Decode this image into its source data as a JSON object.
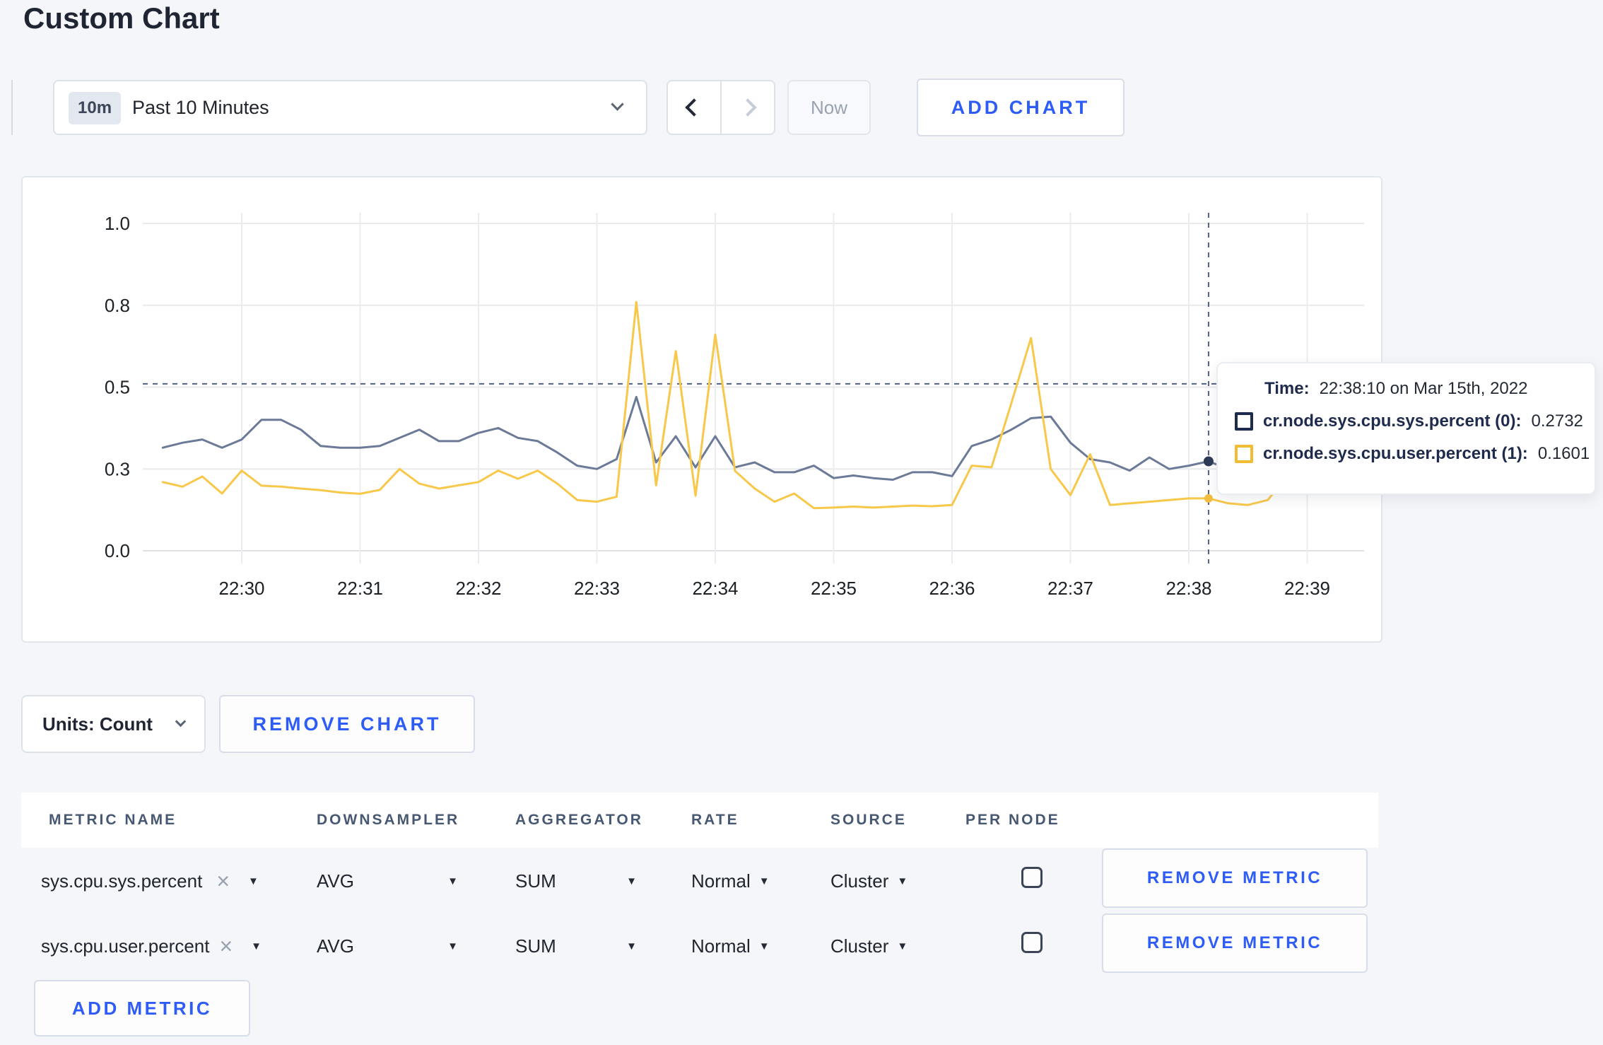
{
  "page_title": "Custom Chart",
  "icons": {
    "caret_down": "▼",
    "close": "×"
  },
  "colors": {
    "accent_blue": "#2e5cf6",
    "series_sys": "#6b7a96",
    "series_user": "#f8c84b",
    "swatch_sys": "#1e2b4d",
    "swatch_user": "#f0bc33",
    "crosshair": "#51607e",
    "page_bg": "#f4f6f9"
  },
  "toolbar": {
    "range_badge": "10m",
    "range_label": "Past 10 Minutes",
    "now_label": "Now",
    "add_chart_label": "ADD CHART"
  },
  "chart_data": {
    "type": "line",
    "title": "",
    "xlabel": "",
    "ylabel": "",
    "grid": true,
    "legend": "none",
    "ylim": [
      0,
      1
    ],
    "y_ticks": [
      {
        "value": 0,
        "label": "0.0"
      },
      {
        "value": 0.25,
        "label": "0.3"
      },
      {
        "value": 0.5,
        "label": "0.5"
      },
      {
        "value": 0.75,
        "label": "0.8"
      },
      {
        "value": 1,
        "label": "1.0"
      }
    ],
    "x_ticks": [
      "22:30",
      "22:31",
      "22:32",
      "22:33",
      "22:34",
      "22:35",
      "22:36",
      "22:37",
      "22:38",
      "22:39"
    ],
    "x_start_time": "22:29:20",
    "x_step_seconds": 10,
    "x0_min": -0.6667,
    "dx_min": 0.16667,
    "series": [
      {
        "name": "cr.node.sys.cpu.sys.percent (0)",
        "color": "#6b7a96",
        "values": [
          0.315,
          0.33,
          0.34,
          0.315,
          0.34,
          0.4,
          0.4,
          0.37,
          0.32,
          0.315,
          0.315,
          0.32,
          0.345,
          0.37,
          0.335,
          0.335,
          0.36,
          0.375,
          0.345,
          0.335,
          0.3,
          0.26,
          0.25,
          0.28,
          0.47,
          0.27,
          0.35,
          0.255,
          0.35,
          0.255,
          0.27,
          0.24,
          0.24,
          0.26,
          0.222,
          0.23,
          0.222,
          0.217,
          0.24,
          0.24,
          0.228,
          0.32,
          0.34,
          0.37,
          0.405,
          0.41,
          0.33,
          0.28,
          0.27,
          0.245,
          0.285,
          0.25,
          0.26,
          0.2732,
          0.25,
          0.24,
          0.245,
          0.27,
          0.3,
          0.295
        ]
      },
      {
        "name": "cr.node.sys.cpu.user.percent (1)",
        "color": "#f8c84b",
        "values": [
          0.21,
          0.196,
          0.227,
          0.175,
          0.245,
          0.199,
          0.196,
          0.19,
          0.185,
          0.178,
          0.174,
          0.186,
          0.25,
          0.205,
          0.19,
          0.2,
          0.21,
          0.245,
          0.22,
          0.245,
          0.205,
          0.155,
          0.15,
          0.165,
          0.76,
          0.2,
          0.61,
          0.168,
          0.66,
          0.244,
          0.19,
          0.15,
          0.175,
          0.13,
          0.132,
          0.135,
          0.132,
          0.135,
          0.138,
          0.136,
          0.14,
          0.26,
          0.255,
          0.45,
          0.65,
          0.25,
          0.17,
          0.295,
          0.14,
          0.145,
          0.15,
          0.155,
          0.16,
          0.1601,
          0.145,
          0.14,
          0.155,
          0.23,
          0.27,
          0.24
        ]
      }
    ],
    "crosshair": {
      "x_min": 8.1667,
      "hline_value": 0.51,
      "dots": [
        {
          "value": 0.2732,
          "color": "#2e3b57"
        },
        {
          "value": 0.1601,
          "color": "#f3bd41"
        }
      ]
    }
  },
  "tooltip": {
    "time_label": "Time:",
    "time_value": "22:38:10 on Mar 15th, 2022",
    "rows": [
      {
        "label": "cr.node.sys.cpu.sys.percent (0):",
        "value": "0.2732",
        "color": "#1e2b4d"
      },
      {
        "label": "cr.node.sys.cpu.user.percent (1):",
        "value": "0.1601",
        "color": "#f0bc33"
      }
    ]
  },
  "chart_footer": {
    "units_label": "Units: Count",
    "remove_chart_label": "REMOVE CHART"
  },
  "metrics_table": {
    "columns": [
      "METRIC NAME",
      "DOWNSAMPLER",
      "AGGREGATOR",
      "RATE",
      "SOURCE",
      "PER NODE"
    ],
    "rows": [
      {
        "metric": "sys.cpu.sys.percent",
        "downsampler": "AVG",
        "aggregator": "SUM",
        "rate": "Normal",
        "source": "Cluster",
        "per_node": false,
        "remove_label": "REMOVE METRIC"
      },
      {
        "metric": "sys.cpu.user.percent",
        "downsampler": "AVG",
        "aggregator": "SUM",
        "rate": "Normal",
        "source": "Cluster",
        "per_node": false,
        "remove_label": "REMOVE METRIC"
      }
    ],
    "add_metric_label": "ADD METRIC"
  }
}
